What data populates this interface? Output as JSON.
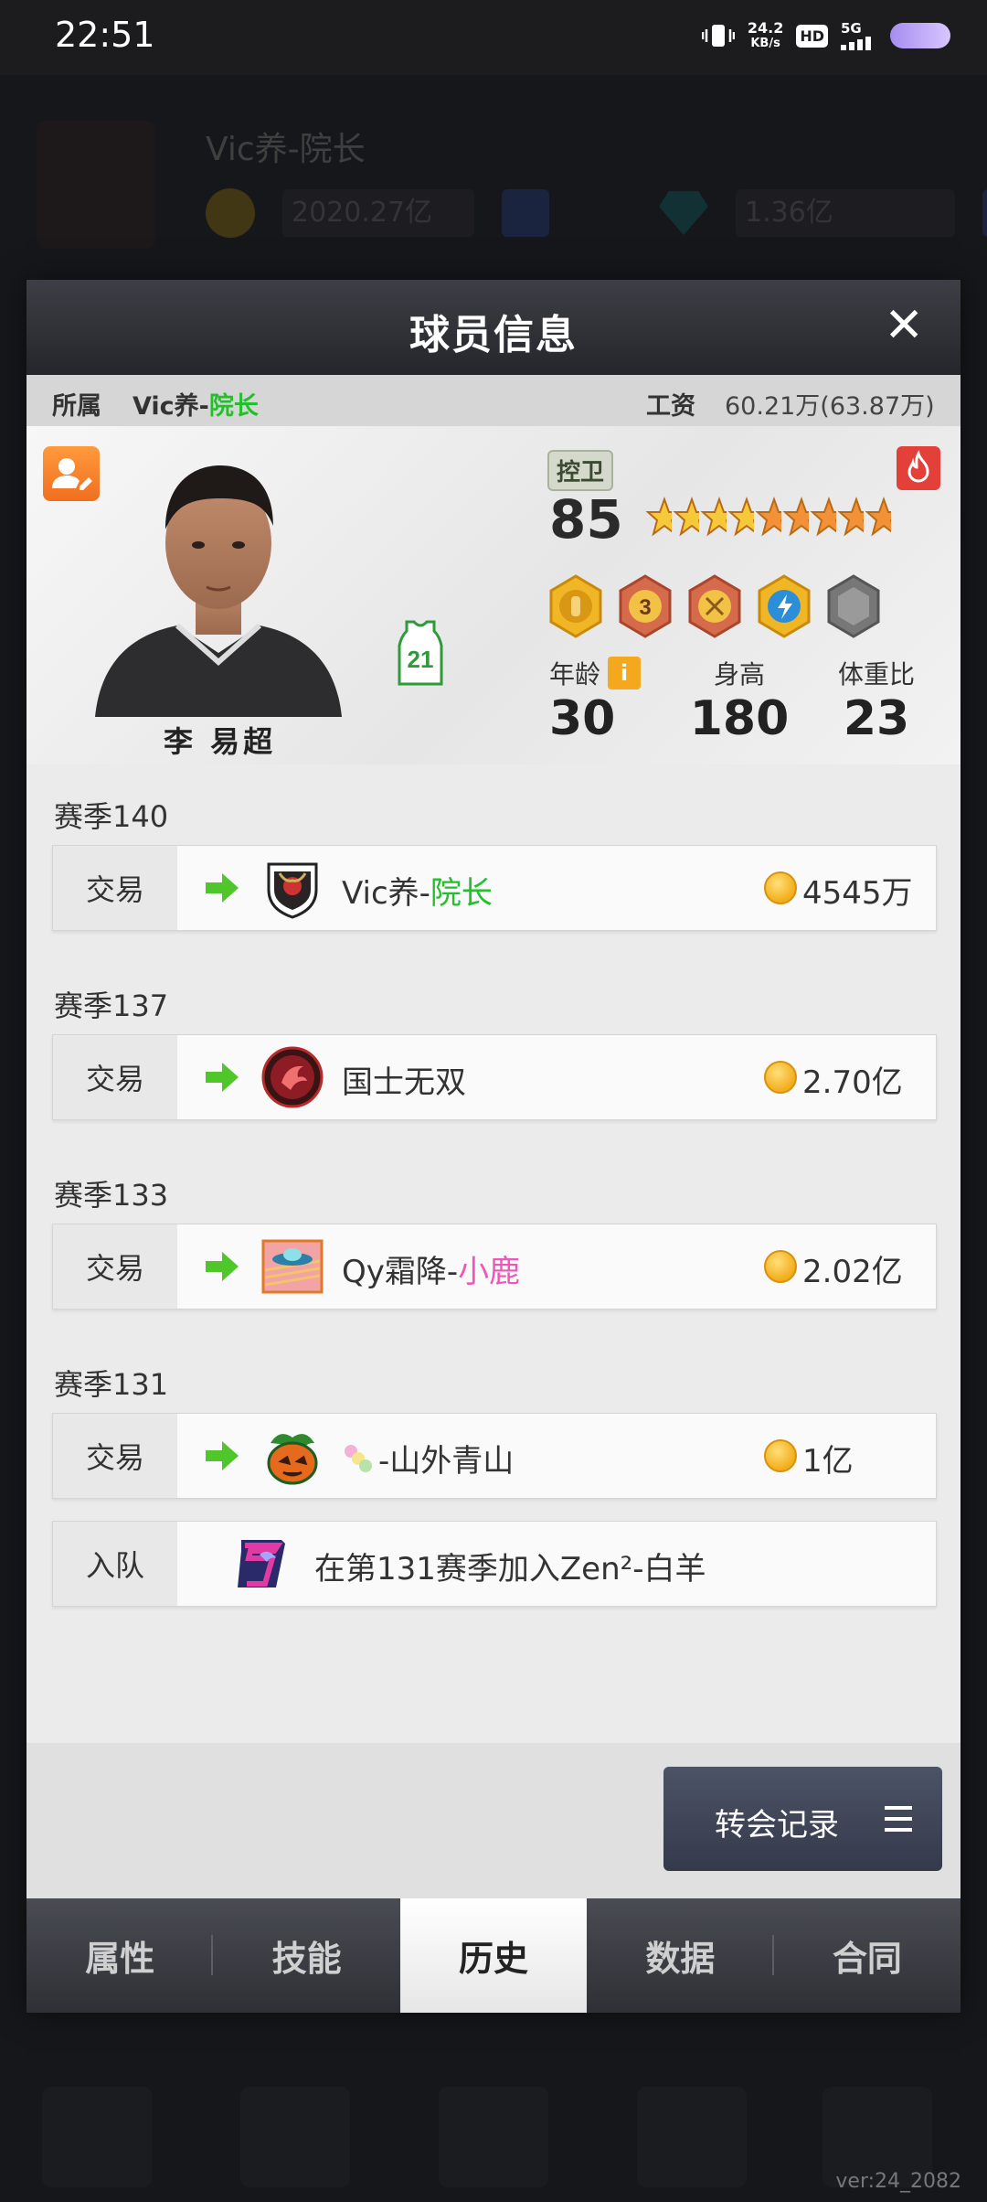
{
  "status_bar": {
    "time": "22:51",
    "net_speed_value": "24.2",
    "net_speed_unit": "KB/s",
    "hd": "HD",
    "network": "5G"
  },
  "background": {
    "team_name": "Vic养-院长",
    "gold": "2020.27亿",
    "diamonds": "1.36亿",
    "version": "ver:24_2082"
  },
  "modal": {
    "title": "球员信息",
    "close_icon": "close-icon",
    "affiliation_label": "所属",
    "affiliation_team_main": "Vic养-",
    "affiliation_team_tag": "院长",
    "salary_label": "工资",
    "salary_value": "60.21万(63.87万)"
  },
  "player": {
    "name": "李 易超",
    "position": "控卫",
    "rating": "85",
    "stars": 9,
    "jersey_number": "21",
    "age_label": "年龄",
    "age_value": "30",
    "height_label": "身高",
    "height_value": "180",
    "weight_ratio_label": "体重比",
    "weight_ratio_value": "23",
    "info_icon": "i"
  },
  "history": [
    {
      "season": "赛季140",
      "type": "交易",
      "team_main": "Vic养-",
      "team_tag": "院长",
      "tag_color": "#22c02a",
      "amount": "4545万"
    },
    {
      "season": "赛季137",
      "type": "交易",
      "team_main": "国士无双",
      "team_tag": "",
      "tag_color": "",
      "amount": "2.70亿"
    },
    {
      "season": "赛季133",
      "type": "交易",
      "team_main": "Qy霜降-",
      "team_tag": "小鹿",
      "tag_color": "#ee57b8",
      "amount": "2.02亿"
    },
    {
      "season": "赛季131",
      "type": "交易",
      "team_main": "-山外青山",
      "team_tag": "",
      "tag_color": "",
      "amount": "1亿"
    },
    {
      "season": "",
      "type": "入队",
      "join_text": "在第131赛季加入Zen²-白羊"
    }
  ],
  "footer": {
    "transfer_button": "转会记录",
    "menu_icon": "menu-icon"
  },
  "tabs": [
    "属性",
    "技能",
    "历史",
    "数据",
    "合同"
  ],
  "active_tab": "历史"
}
